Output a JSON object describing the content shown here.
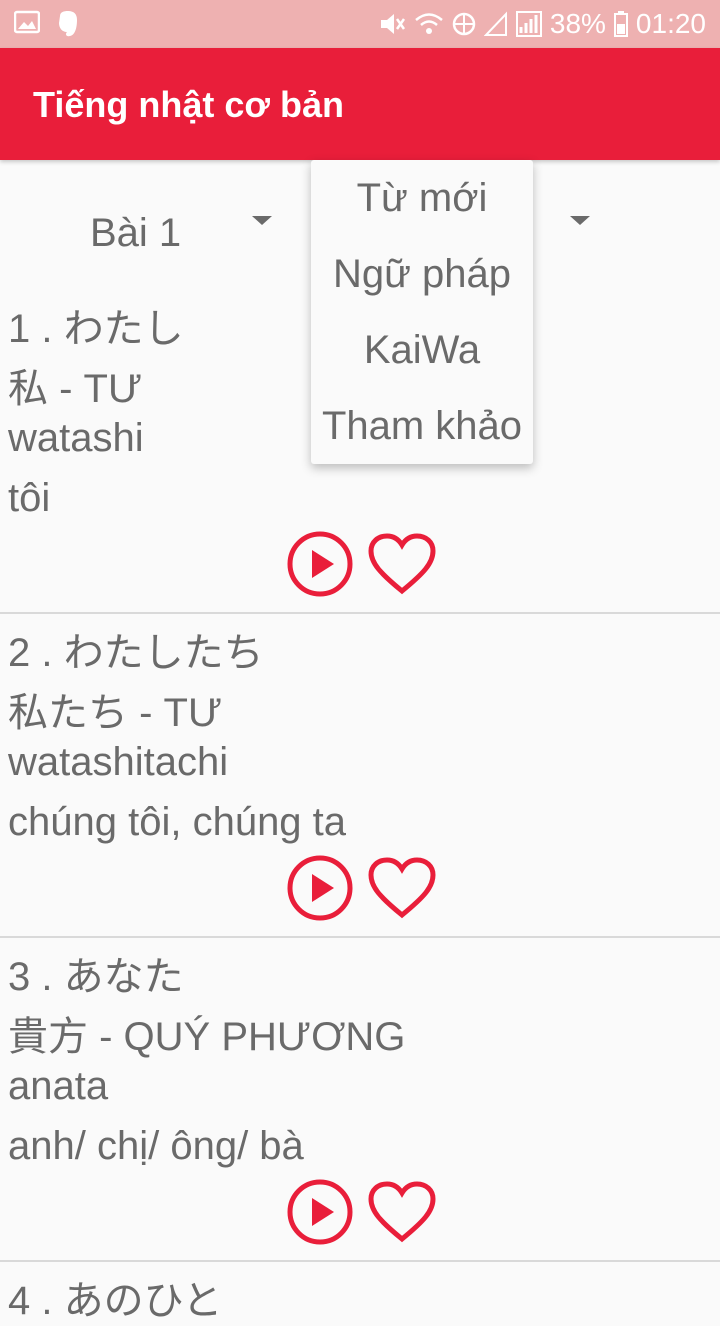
{
  "status_bar": {
    "battery": "38%",
    "time": "01:20"
  },
  "app_bar": {
    "title": "Tiếng nhật cơ bản"
  },
  "lesson_spinner": {
    "selected": "Bài 1"
  },
  "category_dropdown": {
    "options": [
      "Từ mới",
      "Ngữ pháp",
      "KaiWa",
      "Tham khảo"
    ]
  },
  "words": [
    {
      "kana": "1 . わたし",
      "kanji": "私 - TƯ",
      "romaji": "watashi",
      "meaning": "tôi"
    },
    {
      "kana": "2 . わたしたち",
      "kanji": "私たち - TƯ",
      "romaji": "watashitachi",
      "meaning": "chúng tôi, chúng ta"
    },
    {
      "kana": "3 . あなた",
      "kanji": "貴方 - QUÝ PHƯƠNG",
      "romaji": "anata",
      "meaning": "anh/ chị/ ông/ bà"
    },
    {
      "kana": "4 . あのひと"
    }
  ],
  "colors": {
    "accent": "#e91e3a",
    "status_bar": "#eeb1b1",
    "text": "#6a6a6a"
  },
  "icons": {
    "play": "play-circle-icon",
    "favorite": "heart-outline-icon"
  }
}
